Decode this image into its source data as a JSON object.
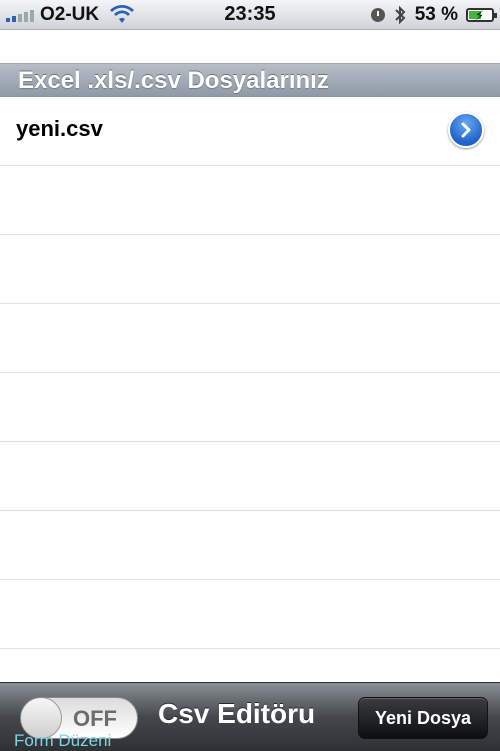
{
  "status_bar": {
    "carrier": "O2-UK",
    "time": "23:35",
    "battery_percent": "53 %",
    "battery_level": 0.53,
    "icons": [
      "signal-icon",
      "wifi-icon",
      "alarm-icon",
      "bluetooth-icon",
      "battery-icon"
    ]
  },
  "section": {
    "title": "Excel .xls/.csv Dosyalarınız"
  },
  "files": [
    {
      "name": "yeni.csv"
    }
  ],
  "empty_row_count": 7,
  "toolbar": {
    "toggle_state": "OFF",
    "toggle_caption": "Form Düzeni",
    "title": "Csv Editöru",
    "new_file_label": "Yeni Dosya"
  },
  "colors": {
    "accent_blue": "#1f62c8",
    "header_gradient": "#9aa5b1",
    "toolbar_dark": "#3a3d41",
    "caption_cyan": "#7fd3e8"
  }
}
